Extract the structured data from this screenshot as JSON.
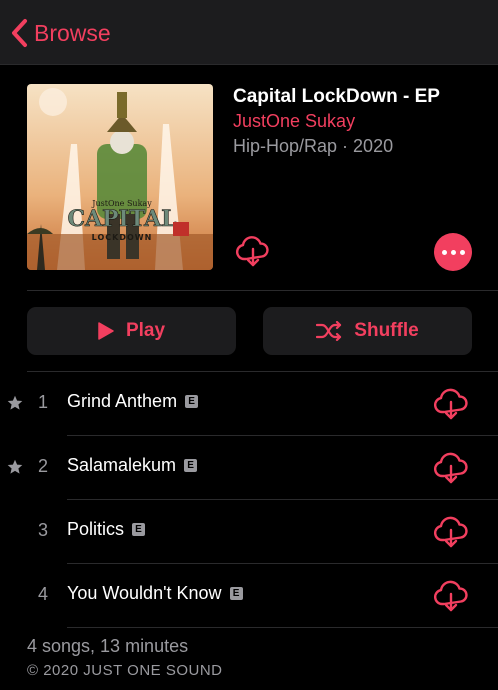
{
  "nav": {
    "back_label": "Browse"
  },
  "album": {
    "title": "Capital LockDown - EP",
    "artist": "JustOne Sukay",
    "genre_year": "Hip-Hop/Rap · 2020",
    "art_text": {
      "top": "JustOne Sukay",
      "main": "CAPITAL",
      "sub": "LOCKDOWN"
    }
  },
  "actions": {
    "play_label": "Play",
    "shuffle_label": "Shuffle"
  },
  "tracks": [
    {
      "number": "1",
      "title": "Grind Anthem",
      "explicit": "E",
      "starred": true
    },
    {
      "number": "2",
      "title": "Salamalekum",
      "explicit": "E",
      "starred": true
    },
    {
      "number": "3",
      "title": "Politics",
      "explicit": "E",
      "starred": false
    },
    {
      "number": "4",
      "title": "You Wouldn't Know",
      "explicit": "E",
      "starred": false
    }
  ],
  "footer": {
    "summary": "4 songs, 13 minutes",
    "copyright": "© 2020 JUST ONE SOUND"
  },
  "colors": {
    "accent": "#f23f5f",
    "secondary_text": "#9a9a9f",
    "background": "#000000",
    "surface": "#1c1c1e"
  },
  "icons": [
    "chevron-left-icon",
    "cloud-download-icon",
    "more-icon",
    "play-icon",
    "shuffle-icon",
    "star-icon",
    "explicit-icon"
  ]
}
